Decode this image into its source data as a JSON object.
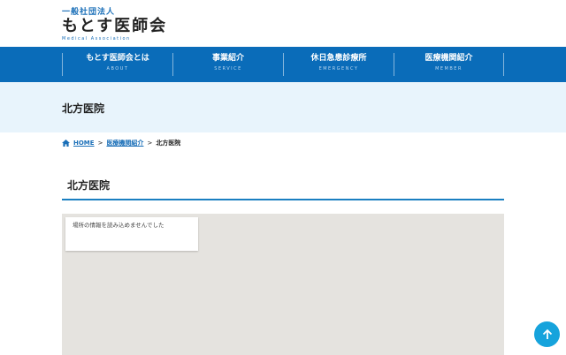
{
  "logo": {
    "sub": "一般社団法人",
    "main": "もとす医師会",
    "en": "Medical Association"
  },
  "nav": [
    {
      "jp": "もとす医師会とは",
      "en": "ABOUT"
    },
    {
      "jp": "事業紹介",
      "en": "SERVICE"
    },
    {
      "jp": "休日急患診療所",
      "en": "EMERGENCY"
    },
    {
      "jp": "医療機関紹介",
      "en": "MEMBER"
    }
  ],
  "page_title": "北方医院",
  "breadcrumb": {
    "home": "HOME",
    "sep": ">",
    "parent": "医療機関紹介",
    "current": "北方医院"
  },
  "section_title": "北方医院",
  "map": {
    "error": "場所の情報を読み込めませんでした"
  },
  "colors": {
    "nav": "#0a6cb9",
    "band": "#e8f4fc",
    "accent": "#16a3dc"
  }
}
